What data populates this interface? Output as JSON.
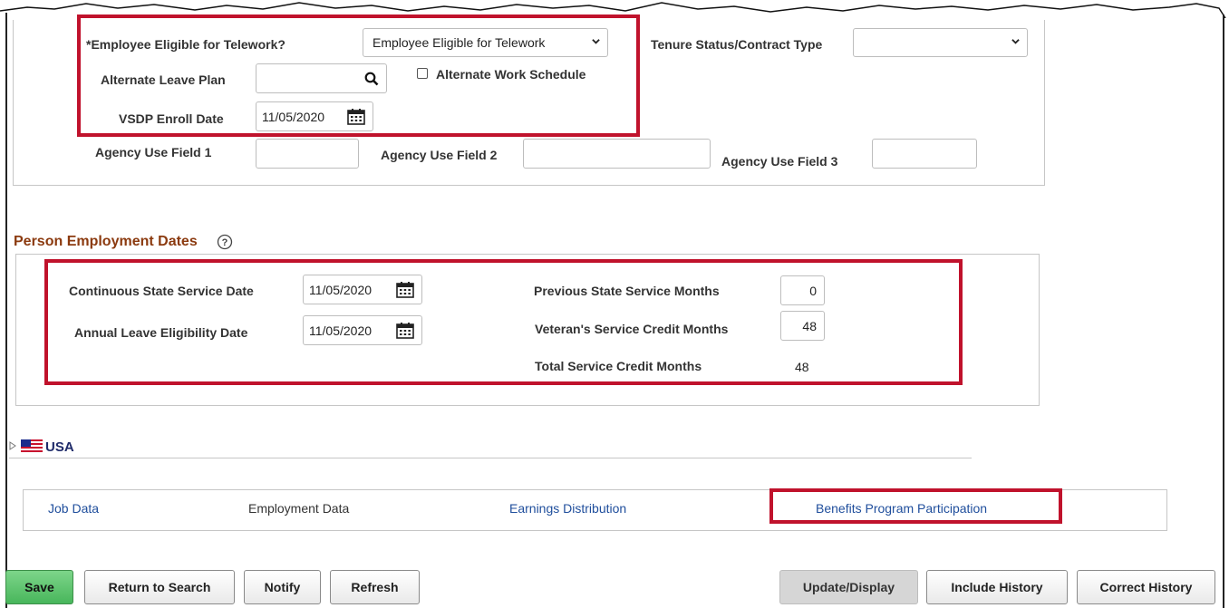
{
  "telework": {
    "eligible_label": "*Employee Eligible for Telework?",
    "eligible_value": "Employee Eligible for Telework",
    "tenure_label": "Tenure Status/Contract Type",
    "tenure_value": "",
    "alt_leave_label": "Alternate Leave Plan",
    "alt_work_label": "Alternate Work Schedule",
    "vsdp_label": "VSDP Enroll Date",
    "vsdp_value": "11/05/2020",
    "agency1_label": "Agency Use Field 1",
    "agency2_label": "Agency Use Field 2",
    "agency3_label": "Agency Use Field 3"
  },
  "dates": {
    "title": "Person Employment Dates",
    "continuous_label": "Continuous State Service Date",
    "continuous_value": "11/05/2020",
    "annual_label": "Annual Leave Eligibility Date",
    "annual_value": "11/05/2020",
    "prev_months_label": "Previous State Service Months",
    "prev_months_value": "0",
    "veteran_label": "Veteran's Service Credit Months",
    "veteran_value": "48",
    "total_label": "Total Service Credit Months",
    "total_value": "48"
  },
  "usa": {
    "label": "USA"
  },
  "tabs": [
    {
      "label": "Job Data"
    },
    {
      "label": "Employment Data"
    },
    {
      "label": "Earnings Distribution"
    },
    {
      "label": "Benefits Program Participation"
    }
  ],
  "buttons": {
    "save": "Save",
    "return_to_search": "Return to Search",
    "notify": "Notify",
    "refresh": "Refresh",
    "update_display": "Update/Display",
    "include_history": "Include History",
    "correct_history": "Correct History"
  },
  "colors": {
    "highlight": "#c0122c",
    "link": "#1f4e9c",
    "section_title": "#8b3a0f",
    "save_green": "#48b65b"
  }
}
